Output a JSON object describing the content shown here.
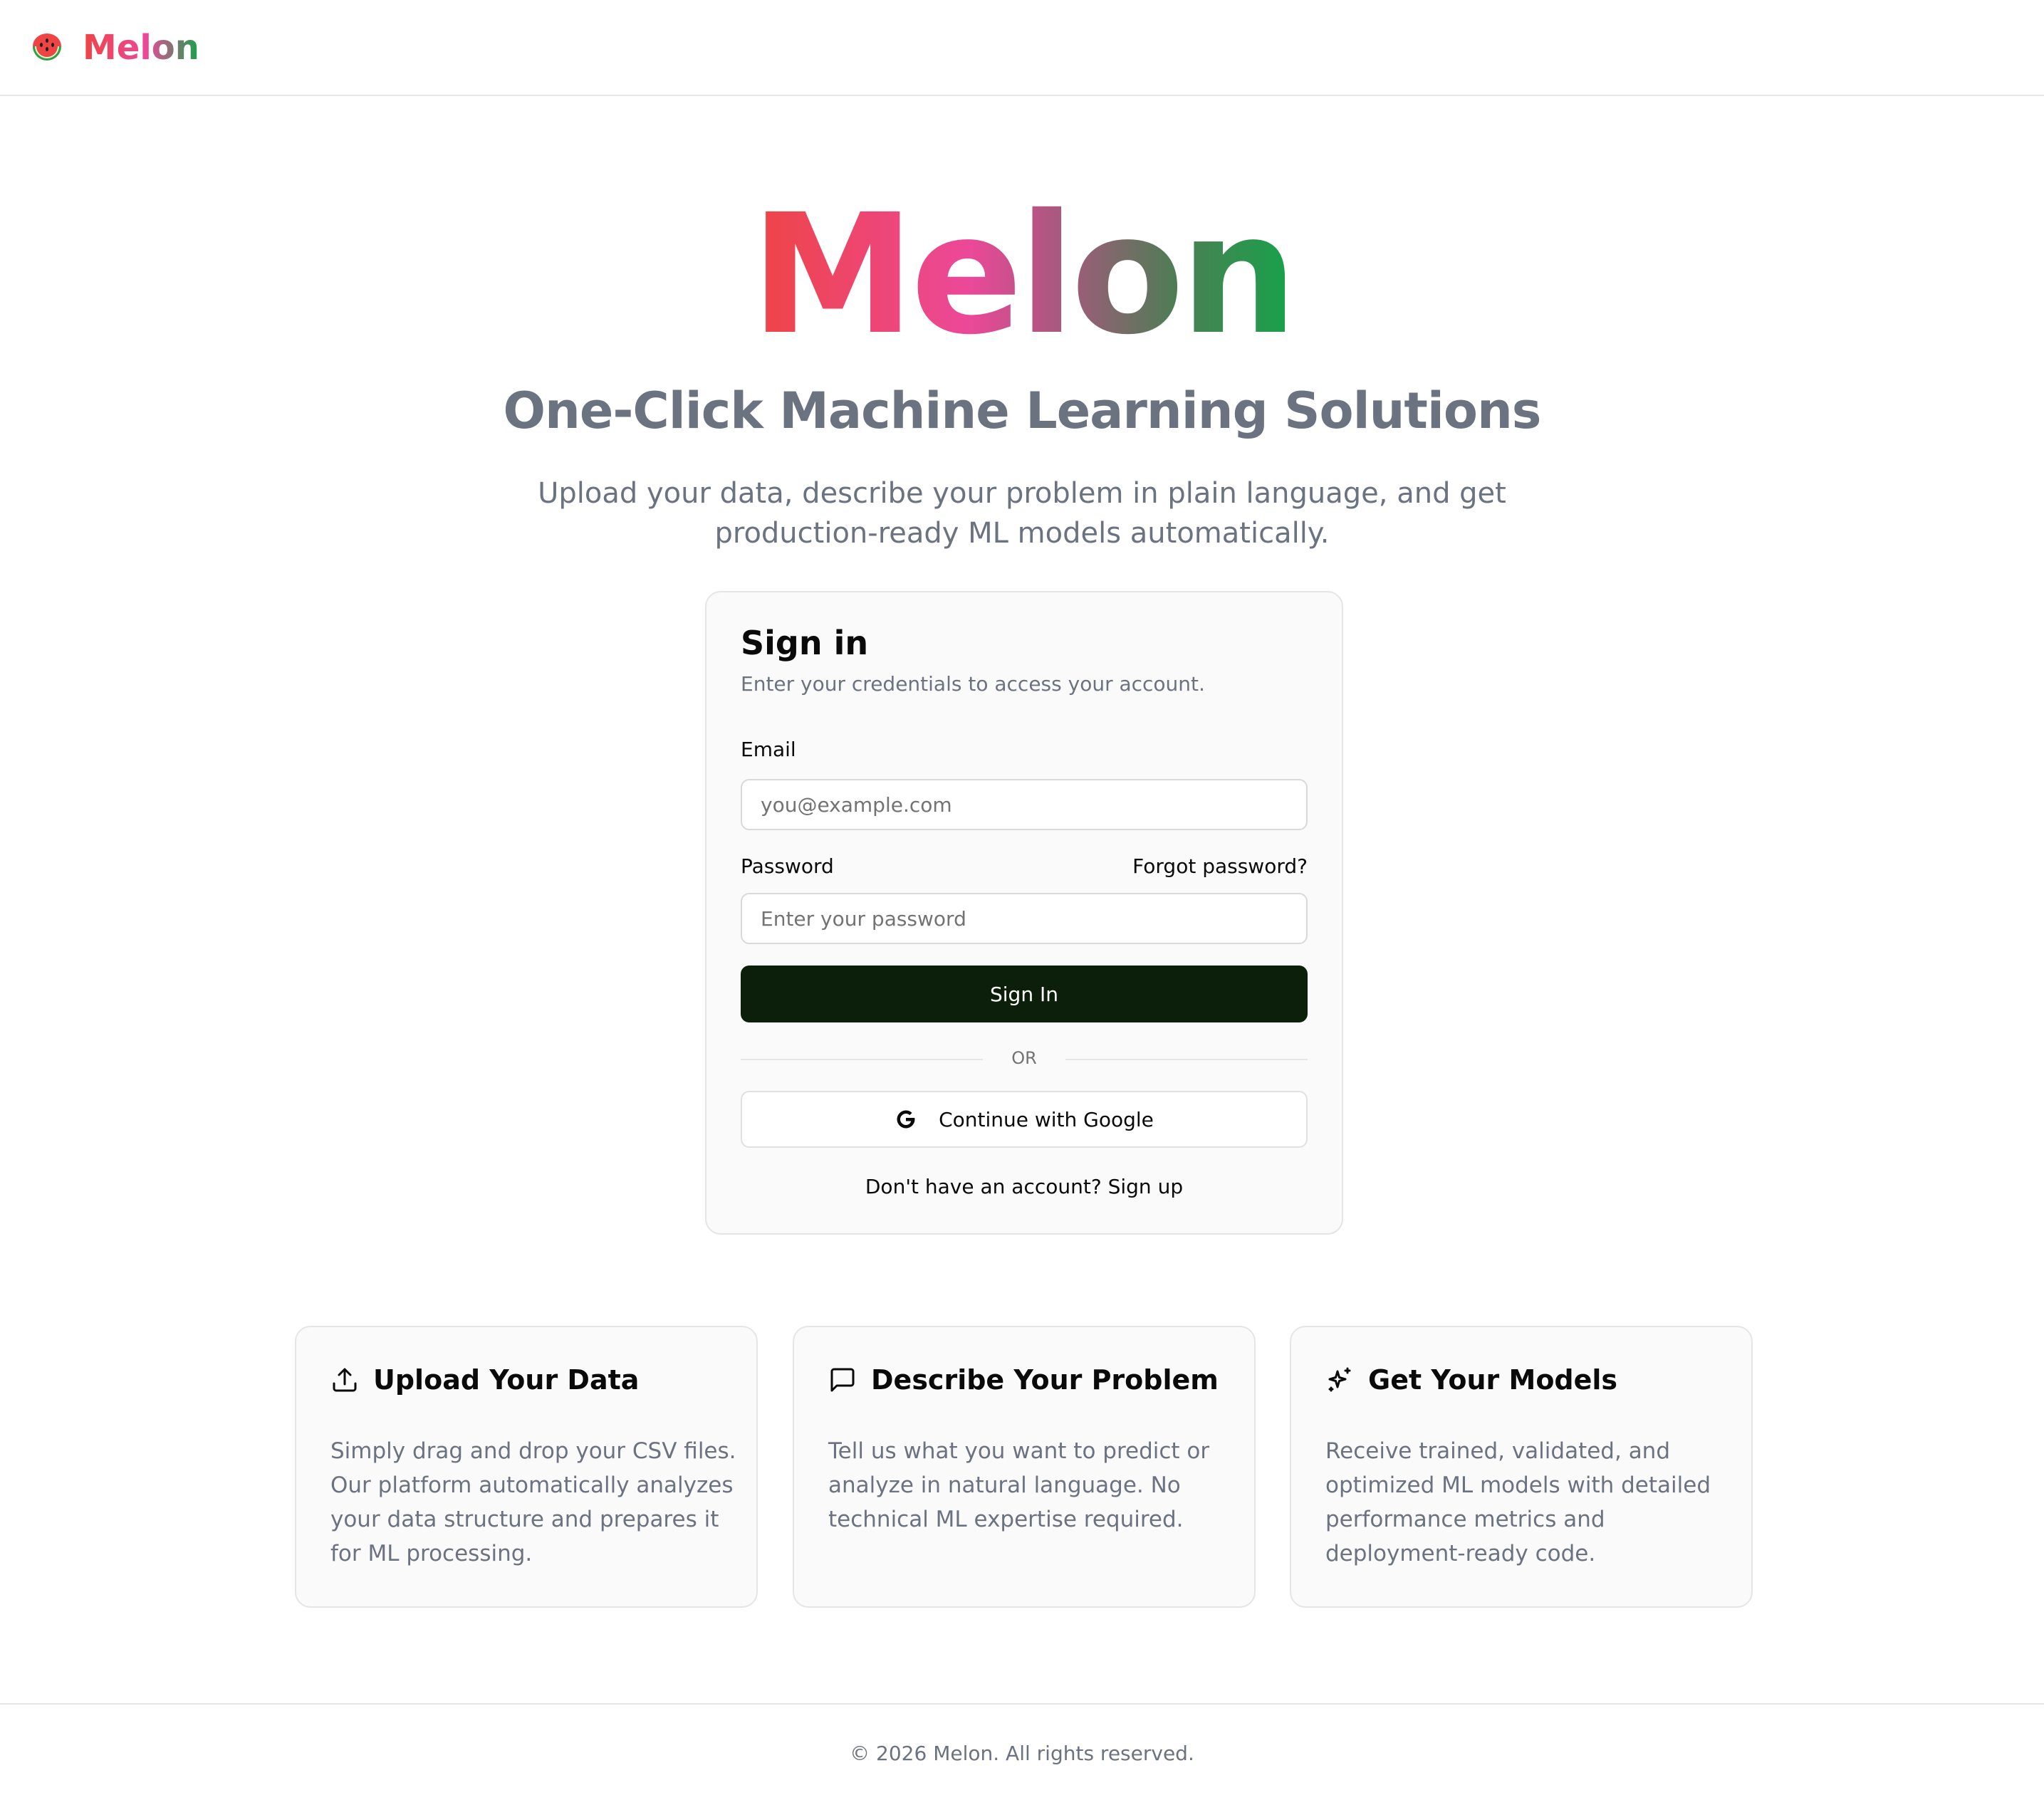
{
  "header": {
    "brand_name": "Melon",
    "logo_icon": "watermelon-icon"
  },
  "hero": {
    "title": "Melon",
    "subtitle": "One-Click Machine Learning Solutions",
    "description": "Upload your data, describe your problem in plain language, and get production-ready ML models automatically."
  },
  "signin": {
    "title": "Sign in",
    "description": "Enter your credentials to access your account.",
    "email_label": "Email",
    "email_placeholder": "you@example.com",
    "email_value": "",
    "password_label": "Password",
    "password_placeholder": "Enter your password",
    "password_value": "",
    "forgot_label": "Forgot password?",
    "submit_label": "Sign In",
    "divider_label": "OR",
    "google_label": "Continue with Google",
    "google_icon": "google-icon",
    "signup_text": "Don't have an account? Sign up"
  },
  "features": [
    {
      "icon": "upload-icon",
      "title": "Upload Your Data",
      "text": "Simply drag and drop your CSV files. Our platform automatically analyzes your data structure and prepares it for ML processing."
    },
    {
      "icon": "message-square-icon",
      "title": "Describe Your Problem",
      "text": "Tell us what you want to predict or analyze in natural language. No technical ML expertise required."
    },
    {
      "icon": "sparkles-icon",
      "title": "Get Your Models",
      "text": "Receive trained, validated, and optimized ML models with detailed performance metrics and deployment-ready code."
    }
  ],
  "footer": {
    "text": "© 2026 Melon. All rights reserved."
  },
  "colors": {
    "primary_button": "#0c1f0a",
    "gradient_start": "#ef4444",
    "gradient_mid": "#ec4899",
    "gradient_end": "#16a34a",
    "muted_text": "#6b7280"
  }
}
